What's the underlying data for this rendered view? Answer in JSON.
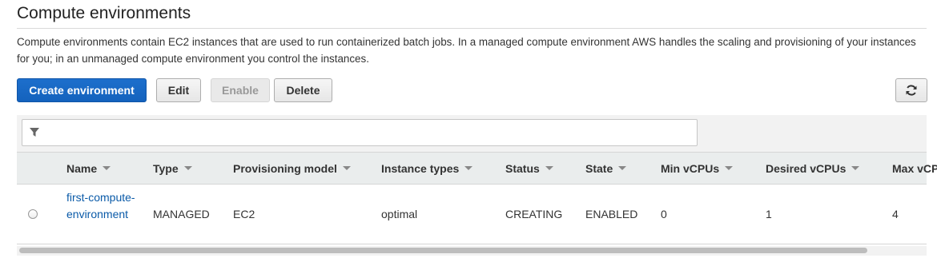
{
  "page": {
    "title": "Compute environments",
    "description": "Compute environments contain EC2 instances that are used to run containerized batch jobs. In a managed compute environment AWS handles the scaling and provisioning of your instances for you; in an unmanaged compute environment you control the instances."
  },
  "toolbar": {
    "create_label": "Create environment",
    "edit_label": "Edit",
    "enable_label": "Enable",
    "delete_label": "Delete",
    "refresh_icon": "refresh-icon"
  },
  "filter": {
    "placeholder": "",
    "icon": "filter-icon"
  },
  "table": {
    "columns": [
      "Name",
      "Type",
      "Provisioning model",
      "Instance types",
      "Status",
      "State",
      "Min vCPUs",
      "Desired vCPUs",
      "Max vCPUs"
    ],
    "rows": [
      {
        "selected": false,
        "name": "first-compute-environment",
        "type": "MANAGED",
        "provisioning_model": "EC2",
        "instance_types": "optimal",
        "status": "CREATING",
        "state": "ENABLED",
        "min_vcpus": "0",
        "desired_vcpus": "1",
        "max_vcpus": "4"
      }
    ]
  },
  "colors": {
    "primary": "#1462bd",
    "link": "#0a5aa8",
    "header_bg": "#eaeded"
  }
}
